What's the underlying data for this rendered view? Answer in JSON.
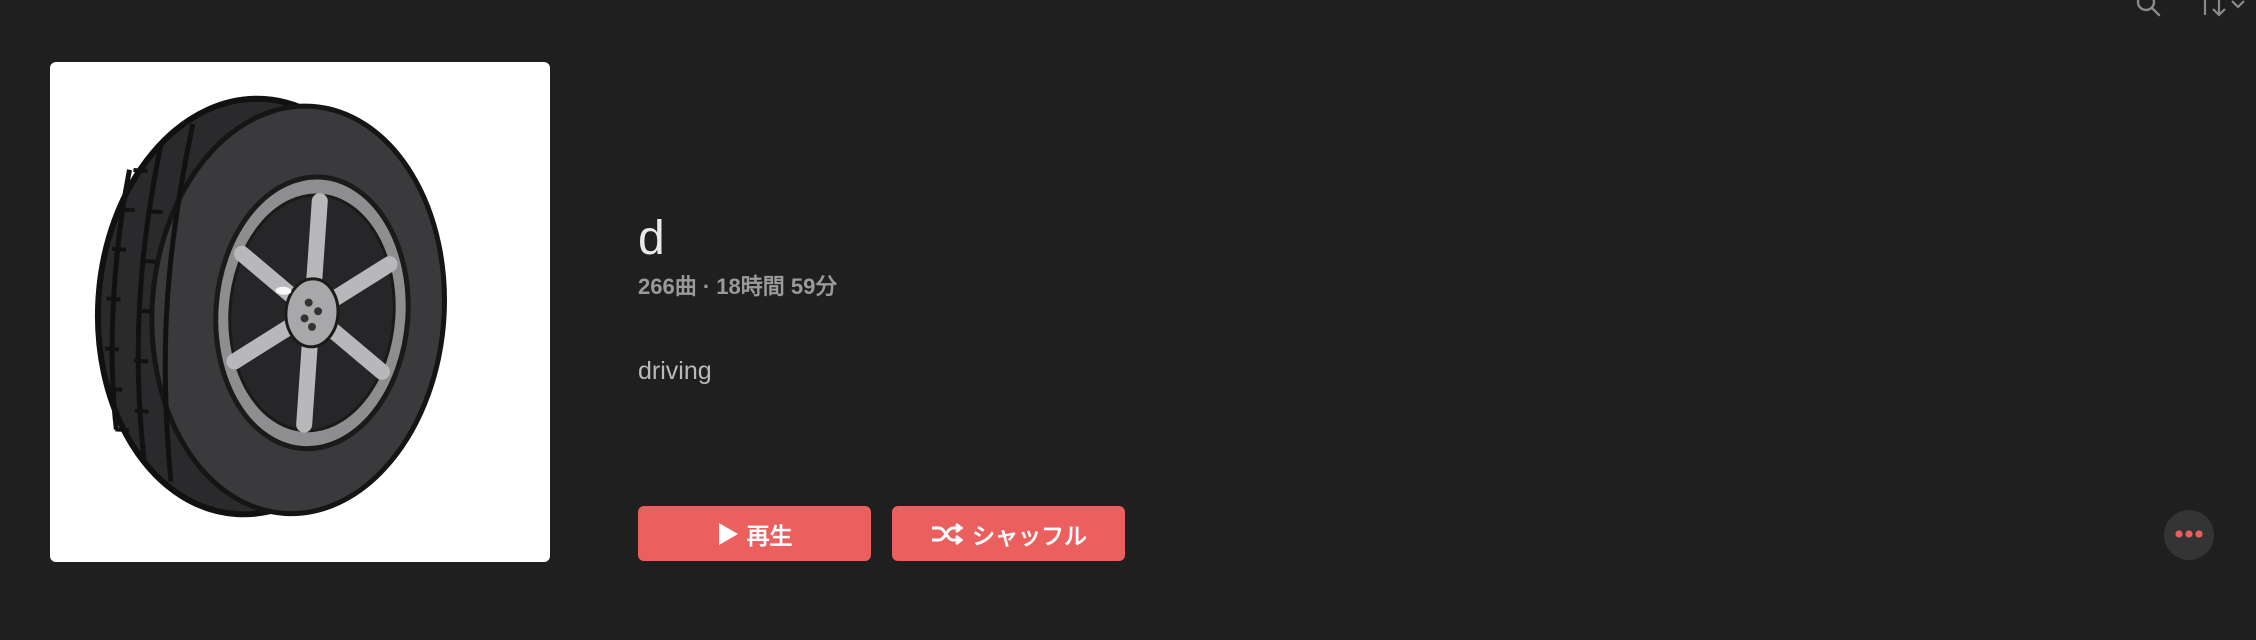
{
  "playlist": {
    "title": "d",
    "meta": "266曲 · 18時間 59分",
    "description": "driving",
    "artwork_icon": "car-tire-icon"
  },
  "actions": {
    "play_label": "再生",
    "play_icon": "play-icon",
    "shuffle_label": "シャッフル",
    "shuffle_icon": "shuffle-icon"
  },
  "toolbar": {
    "search_icon": "search-icon",
    "sort_icon": "sort-arrows-icon",
    "sort_menu_icon": "chevron-down-icon",
    "more_icon": "ellipsis-icon"
  },
  "colors": {
    "background": "#1f1f1f",
    "accent": "#ec5f5f",
    "title_text": "#e9e9e9",
    "meta_text": "#9a9a9a"
  }
}
